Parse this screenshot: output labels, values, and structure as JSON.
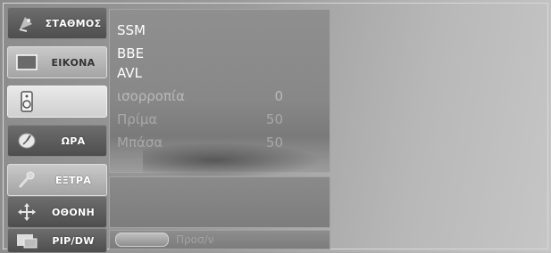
{
  "sidebar": {
    "items": [
      {
        "label": "ΣΤΑΘΜΟΣ",
        "icon": "satellite-dish-icon"
      },
      {
        "label": "ΕΙΚΟΝΑ",
        "icon": "picture-icon"
      },
      {
        "label": "",
        "icon": "speaker-icon"
      },
      {
        "label": "ΩΡΑ",
        "icon": "clock-icon"
      },
      {
        "label": "ΕΞΤΡΑ",
        "icon": "key-icon"
      },
      {
        "label": "ΟΘΟΝΗ",
        "icon": "move-arrows-icon"
      },
      {
        "label": "PIP/DW",
        "icon": "pip-icon"
      }
    ]
  },
  "audio_menu": {
    "ssm": {
      "label": "SSM"
    },
    "bbe": {
      "label": "BBE"
    },
    "avl": {
      "label": "AVL"
    },
    "balance": {
      "label": "ισορροπία",
      "value": "0"
    },
    "treble": {
      "label": "Πρίμα",
      "value": "50"
    },
    "bass": {
      "label": "Μπάσα",
      "value": "50"
    }
  },
  "footer": {
    "label": "Προσ/ν"
  }
}
